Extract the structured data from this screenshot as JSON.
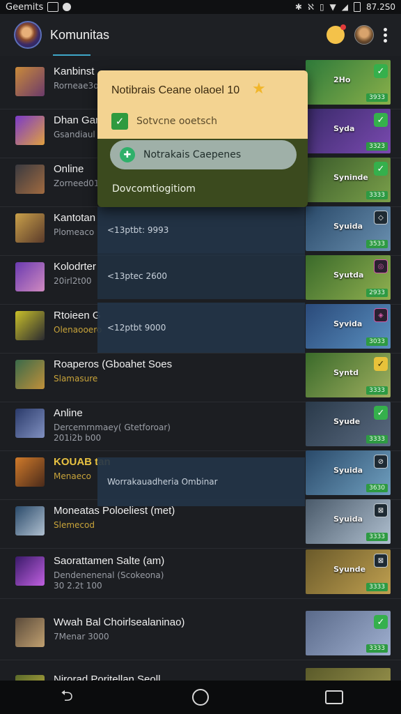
{
  "status_bar": {
    "carrier": "Geemits",
    "clock": "87.2S0",
    "icons": [
      "image-icon",
      "circle-icon",
      "bluetooth-icon",
      "nfc-icon",
      "vibrate-icon",
      "wifi-icon",
      "signal-icon",
      "battery-icon"
    ]
  },
  "header": {
    "title": "Komunitas"
  },
  "popup": {
    "title": "Notibrais Ceane olaoel 10",
    "option_label": "Sotvcne ooetsch",
    "pill_label": "Notrakais Caepenes",
    "footer": "Dovcomtiogitiom"
  },
  "panels": [
    {
      "text": "<13ptbt: 9993"
    },
    {
      "text": "<13ptec 2600"
    },
    {
      "text": "<12ptbt 9000"
    },
    {
      "text": "Worrakauadheria Ombinar"
    }
  ],
  "rows": [
    {
      "title": "Kanbinst",
      "sub": "Rorneae3o",
      "sub2": "",
      "preview_label": "2Ho",
      "badge": "✓",
      "badge_style": "green",
      "count": "3933"
    },
    {
      "title": "Dhan Gan",
      "sub": "Gsandiaul",
      "sub2": "",
      "preview_label": "Syda",
      "badge": "✓",
      "badge_style": "green",
      "count": "3323"
    },
    {
      "title": "Online",
      "sub": "Zorneed01",
      "sub2": "",
      "preview_label": "Syninde",
      "badge": "✓",
      "badge_style": "green",
      "count": "3333"
    },
    {
      "title": "Kantotan",
      "sub": "Plomeaco",
      "sub2": "",
      "preview_label": "Syuida",
      "badge": "◇",
      "badge_style": "dark",
      "count": "3533"
    },
    {
      "title": "Kolodrter",
      "sub": "20irl2t00",
      "sub2": "",
      "preview_label": "Syutda",
      "badge": "◎",
      "badge_style": "pink",
      "count": "2933"
    },
    {
      "title": "Rtoieen G",
      "sub": "Olenaooero",
      "sub2": "",
      "preview_label": "Syvida",
      "badge": "◈",
      "badge_style": "pink",
      "count": "3033"
    },
    {
      "title": "Roaperos (Gboahet Soes",
      "sub": "Slamasure",
      "sub2": "",
      "preview_label": "Syntd",
      "badge": "✓",
      "badge_style": "yellow",
      "count": "3333"
    },
    {
      "title": "Anline",
      "sub": "Dercemrnmaey( Gtetforoar)",
      "sub2": "201i2b b00",
      "preview_label": "Syude",
      "badge": "✓",
      "badge_style": "green",
      "count": "3333"
    },
    {
      "title": "KOUAB tan",
      "sub": "Menaeco",
      "sub2": "",
      "preview_label": "Syuida",
      "badge": "⊘",
      "badge_style": "dark",
      "count": "3630"
    },
    {
      "title": "Moneatas Poloeliest (met)",
      "sub": "Slemecod",
      "sub2": "",
      "preview_label": "Syuida",
      "badge": "⊠",
      "badge_style": "dark",
      "count": "3333"
    },
    {
      "title": "Saorattamen Salte (am)",
      "sub": "Dendenenenal (Scokeona)",
      "sub2": "30 2.2t 100",
      "preview_label": "Syunde",
      "badge": "⊠",
      "badge_style": "dark",
      "count": "3333"
    },
    {
      "title": "Wwah Bal Choirlsealaninao)",
      "sub": "7Menar 3000",
      "sub2": "",
      "preview_label": "",
      "badge": "✓",
      "badge_style": "green",
      "count": "3333"
    },
    {
      "title": "Nirorad Poritellan Seoll",
      "sub": "",
      "sub2": "",
      "preview_label": "",
      "badge": "",
      "badge_style": "green",
      "count": ""
    }
  ],
  "nav": {
    "back": "back-icon",
    "home": "home-icon",
    "recents": "recents-icon"
  }
}
